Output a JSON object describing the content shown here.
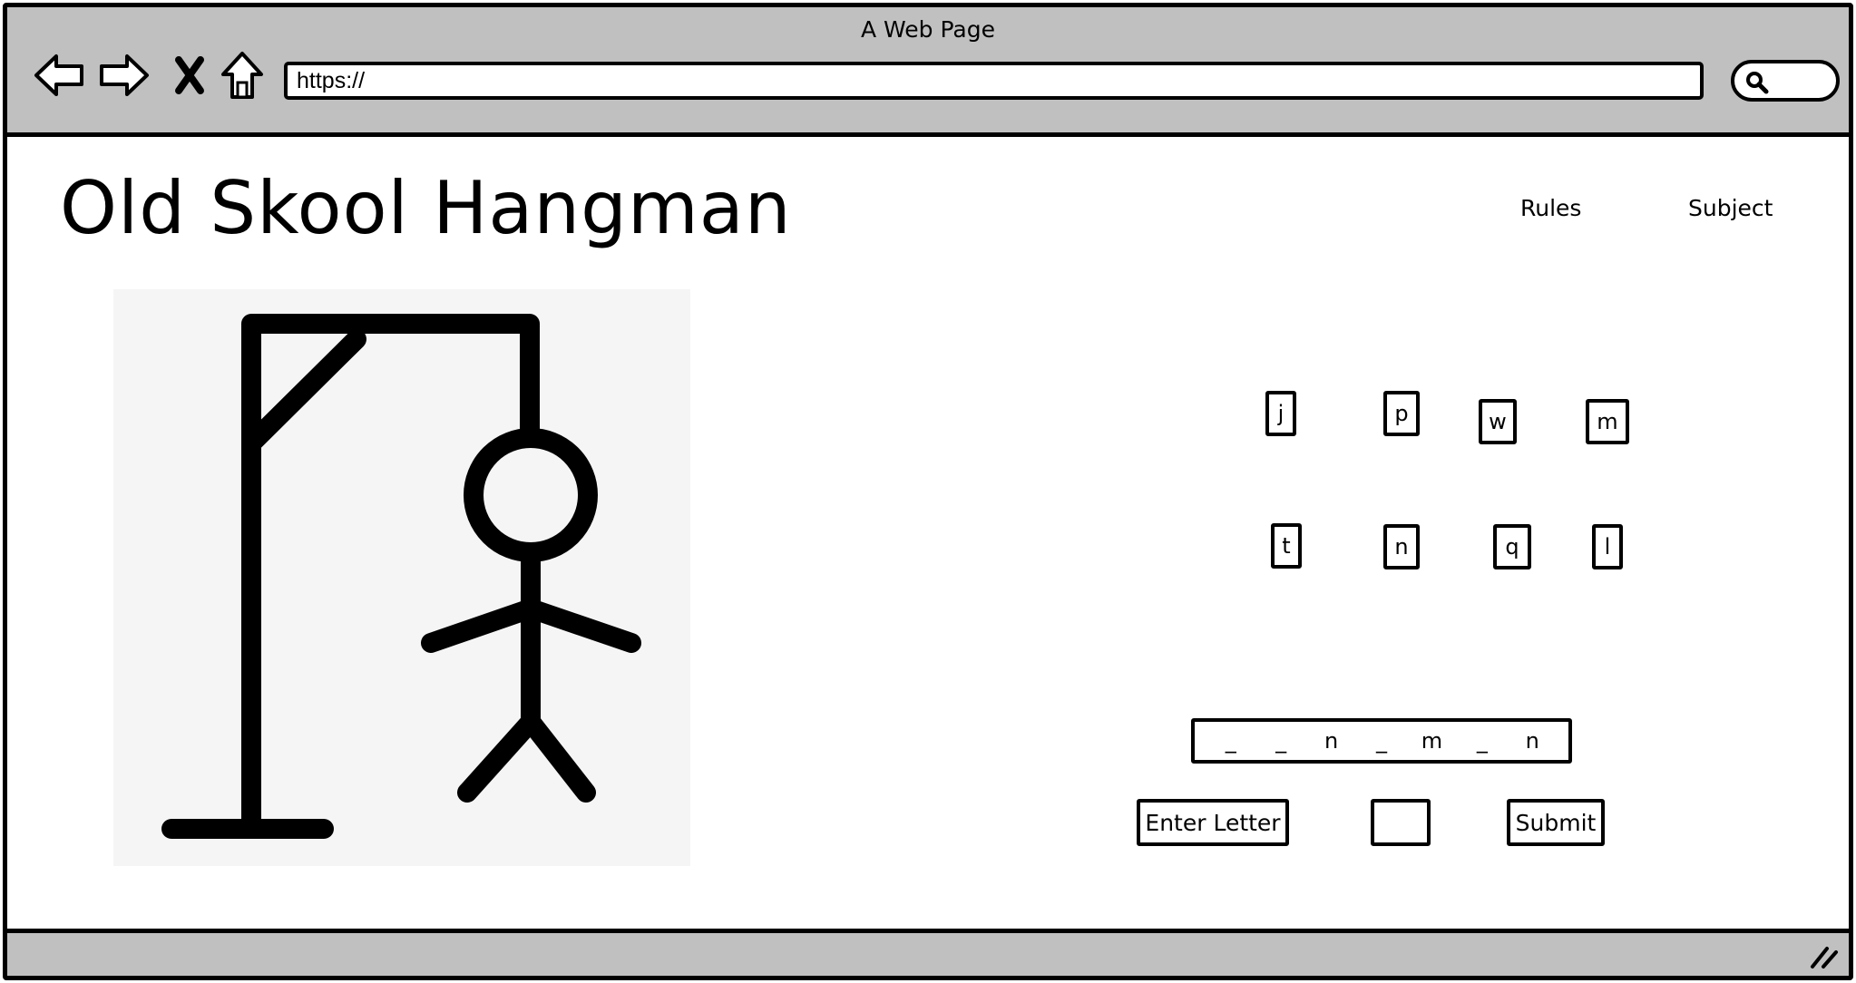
{
  "browser": {
    "window_title": "A Web Page",
    "url": "https://",
    "icons": {
      "back": "back-arrow-icon",
      "forward": "forward-arrow-icon",
      "stop": "close-icon",
      "home": "home-icon",
      "search": "search-icon",
      "resize": "resize-grip-icon"
    }
  },
  "header": {
    "title": "Old Skool Hangman",
    "nav": [
      "Rules",
      "Subject"
    ]
  },
  "game": {
    "image": "hangman-figure",
    "guessed_letters": [
      [
        "j",
        "p",
        "w",
        "m"
      ],
      [
        "t",
        "n",
        "q",
        "l"
      ]
    ],
    "word": [
      "_",
      "_",
      "n",
      "_",
      "m",
      "_",
      "n"
    ],
    "enter_label": "Enter Letter",
    "letter_input_value": "",
    "submit_label": "Submit"
  },
  "colors": {
    "chrome": "#c0c0c0",
    "border": "#000000",
    "page_bg": "#ffffff",
    "image_bg": "#f5f5f5"
  }
}
